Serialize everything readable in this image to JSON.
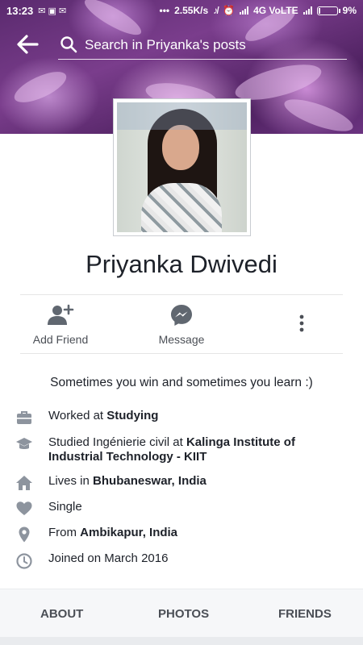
{
  "status_bar": {
    "time": "13:23",
    "net_speed": "2.55K/s",
    "network": "4G VoLTE",
    "battery": "9%",
    "battery_level": 0.09
  },
  "header": {
    "search_placeholder": "Search in Priyanka's posts"
  },
  "profile": {
    "name": "Priyanka Dwivedi",
    "bio": "Sometimes you win and sometimes you learn :)"
  },
  "actions": {
    "add_friend": "Add Friend",
    "message": "Message"
  },
  "info": {
    "work": {
      "prefix": "Worked at ",
      "value": "Studying"
    },
    "education": {
      "prefix": "Studied Ingénierie civil at ",
      "value": "Kalinga Institute of Industrial Technology - KIIT"
    },
    "lives": {
      "prefix": "Lives in ",
      "value": "Bhubaneswar, India"
    },
    "relationship": {
      "text": "Single"
    },
    "from": {
      "prefix": "From ",
      "value": "Ambikapur, India"
    },
    "joined": {
      "text": "Joined on March 2016"
    }
  },
  "tabs": {
    "about": "ABOUT",
    "photos": "PHOTOS",
    "friends": "FRIENDS"
  },
  "colors": {
    "icon": "#8d949e",
    "action_icon": "#606770",
    "accent_purple": "#6b3380"
  }
}
